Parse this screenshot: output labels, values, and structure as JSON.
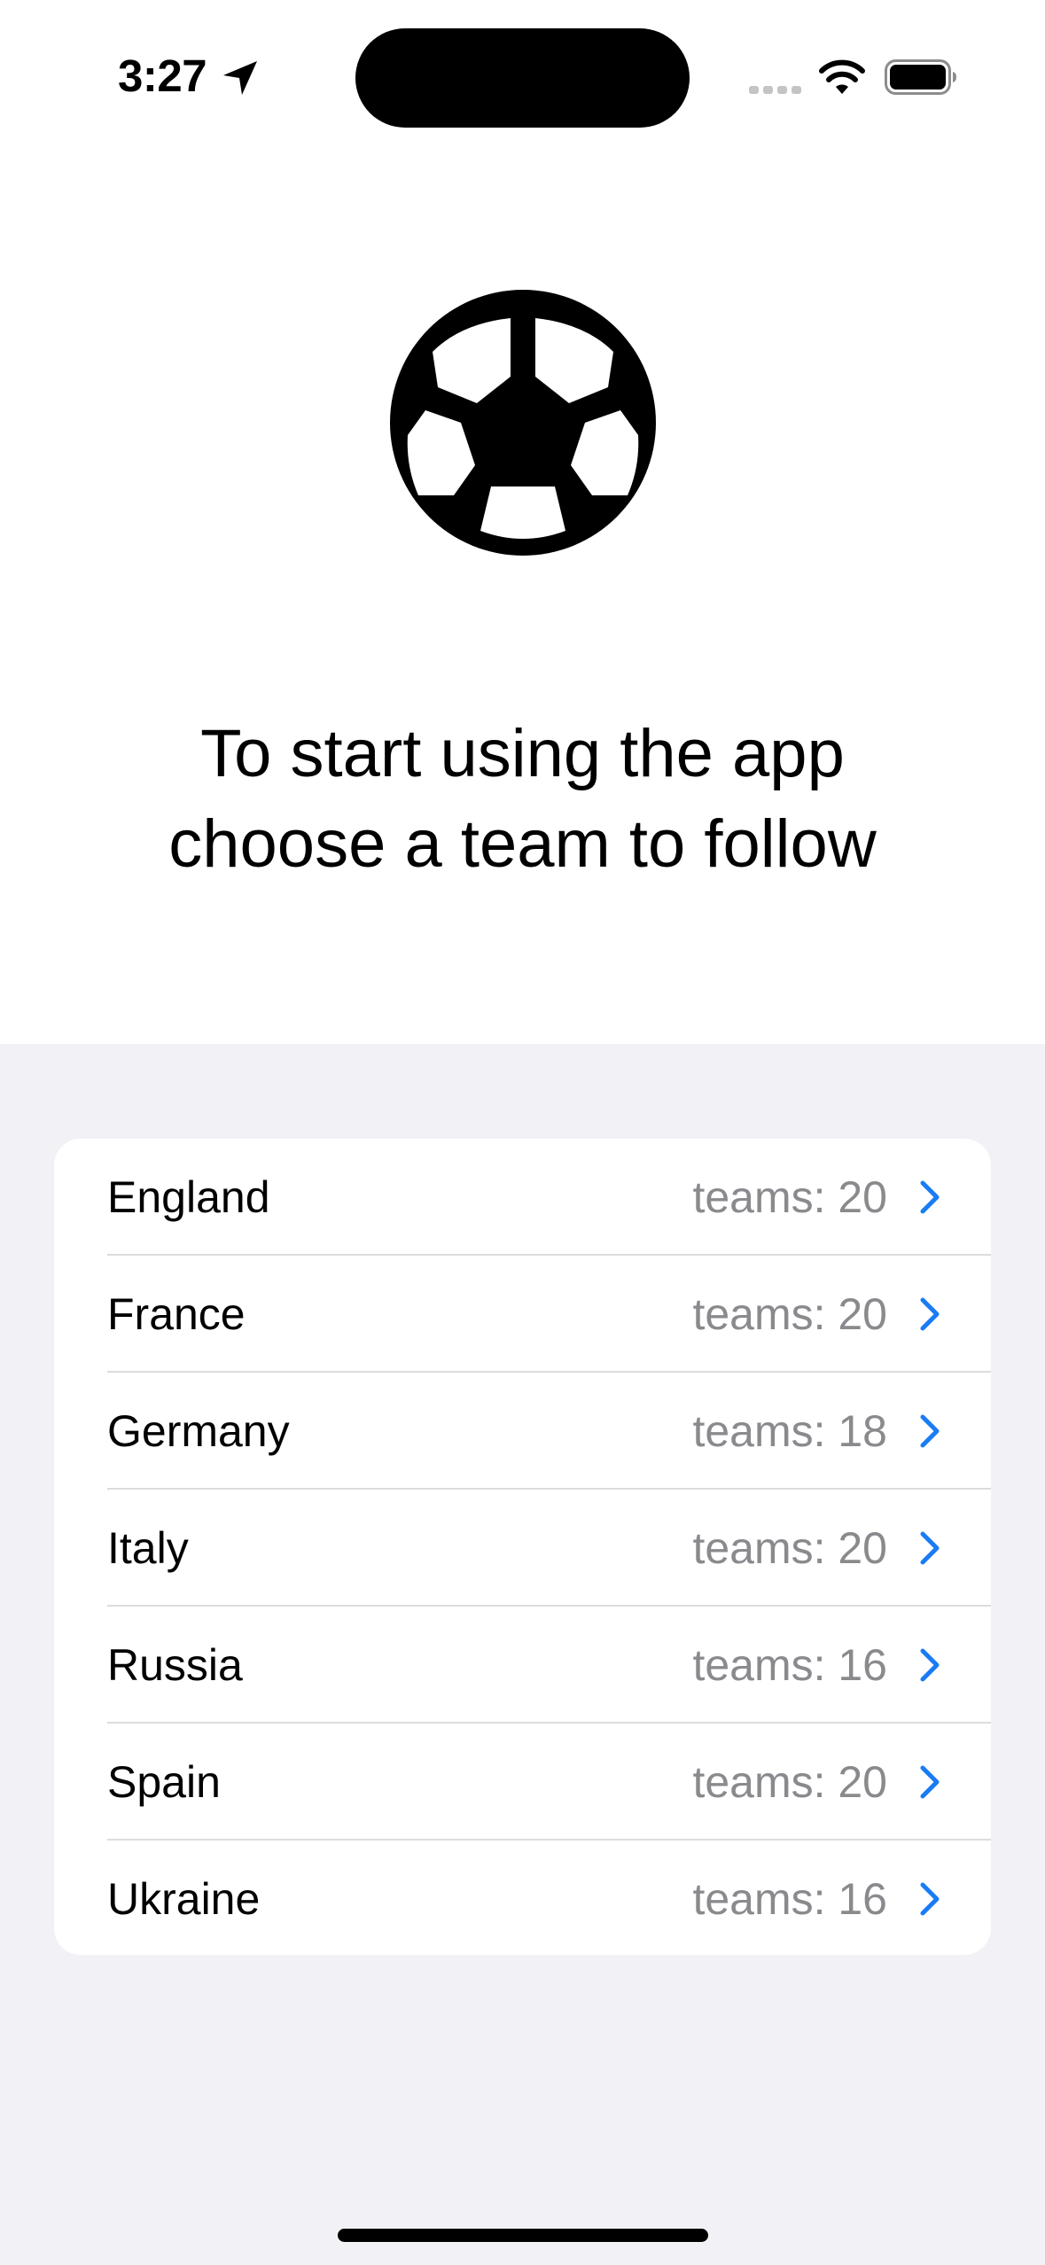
{
  "status_bar": {
    "time": "3:27"
  },
  "header": {
    "icon": "soccer-ball-icon",
    "line1": "To start using the app",
    "line2": "choose a team to follow"
  },
  "leagues": [
    {
      "name": "England",
      "teams": "teams: 20"
    },
    {
      "name": "France",
      "teams": "teams: 20"
    },
    {
      "name": "Germany",
      "teams": "teams: 18"
    },
    {
      "name": "Italy",
      "teams": "teams: 20"
    },
    {
      "name": "Russia",
      "teams": "teams: 16"
    },
    {
      "name": "Spain",
      "teams": "teams: 20"
    },
    {
      "name": "Ukraine",
      "teams": "teams: 16"
    }
  ],
  "colors": {
    "accent": "#1a7cf5",
    "secondary_text": "#8a8a8e",
    "grouped_background": "#f1f1f6"
  }
}
